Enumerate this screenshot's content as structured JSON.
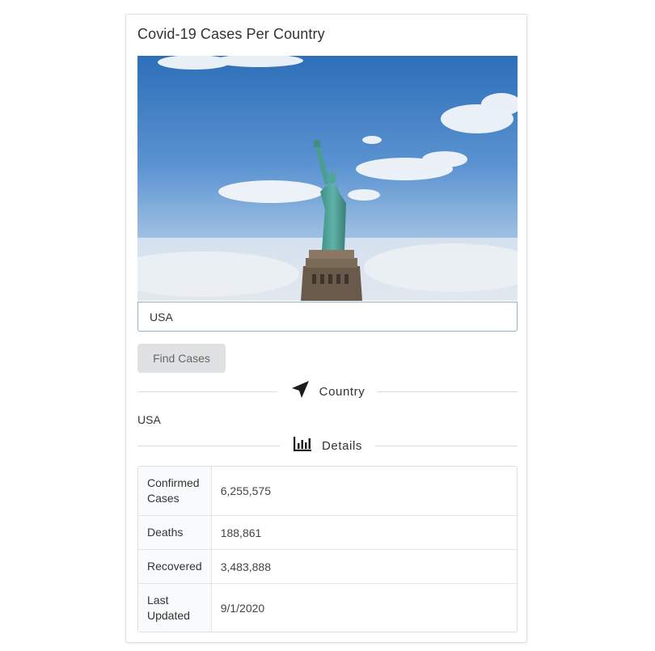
{
  "card": {
    "title": "Covid-19 Cases Per Country"
  },
  "search": {
    "value": "USA"
  },
  "find_button": {
    "label": "Find Cases"
  },
  "country_section": {
    "header": "Country",
    "icon": "location-arrow-icon",
    "value": "USA"
  },
  "details_section": {
    "header": "Details",
    "icon": "bar-chart-icon",
    "rows": [
      {
        "key": "Confirmed Cases",
        "value": "6,255,575"
      },
      {
        "key": "Deaths",
        "value": "188,861"
      },
      {
        "key": "Recovered",
        "value": "3,483,888"
      },
      {
        "key": "Last Updated",
        "value": "9/1/2020"
      }
    ]
  },
  "colors": {
    "input_border": "#8fb3c3",
    "button_bg": "#e0e1e2",
    "divider": "#dcdcdc"
  }
}
